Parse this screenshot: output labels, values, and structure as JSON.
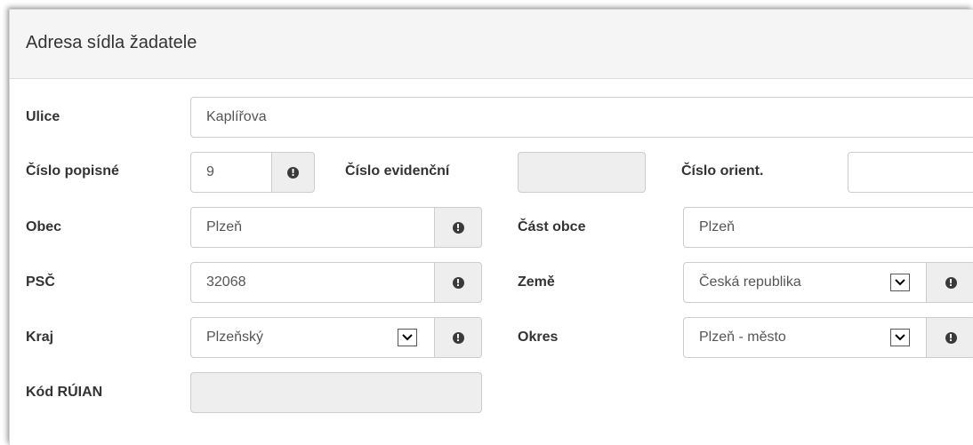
{
  "title": "Adresa sídla žadatele",
  "fields": {
    "ulice": {
      "label": "Ulice",
      "value": "Kaplířova"
    },
    "cislo_popisne": {
      "label": "Číslo popisné",
      "value": "9"
    },
    "cislo_evidencni": {
      "label": "Číslo evidenční",
      "value": ""
    },
    "cislo_orient": {
      "label": "Číslo orient.",
      "value": ""
    },
    "obec": {
      "label": "Obec",
      "value": "Plzeň"
    },
    "cast_obce": {
      "label": "Část obce",
      "value": "Plzeň"
    },
    "psc": {
      "label": "PSČ",
      "value": "32068"
    },
    "zeme": {
      "label": "Země",
      "value": "Česká republika"
    },
    "kraj": {
      "label": "Kraj",
      "value": "Plzeňský"
    },
    "okres": {
      "label": "Okres",
      "value": "Plzeň - město"
    },
    "kod_ruian": {
      "label": "Kód RÚIAN",
      "value": ""
    }
  },
  "icons": {
    "info": "info-circle-icon",
    "dropdown": "chevron-down-icon"
  }
}
